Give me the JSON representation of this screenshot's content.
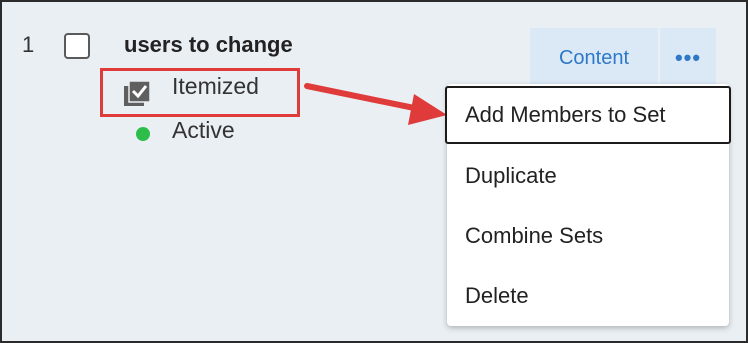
{
  "row": {
    "index": "1",
    "name": "users to change",
    "type_label": "Itemized",
    "type_icon": "itemized-checkbox-icon",
    "status_label": "Active",
    "status_color": "#2ebd4a"
  },
  "actions": {
    "content_label": "Content",
    "more_label": "•••"
  },
  "menu": {
    "items": [
      {
        "label": "Add Members to Set"
      },
      {
        "label": "Duplicate"
      },
      {
        "label": "Combine Sets"
      },
      {
        "label": "Delete"
      }
    ]
  },
  "colors": {
    "annotation_red": "#e03b3b",
    "accent_blue": "#2e78c7",
    "button_bg": "#dbe9f7",
    "page_bg": "#eaeff3"
  }
}
